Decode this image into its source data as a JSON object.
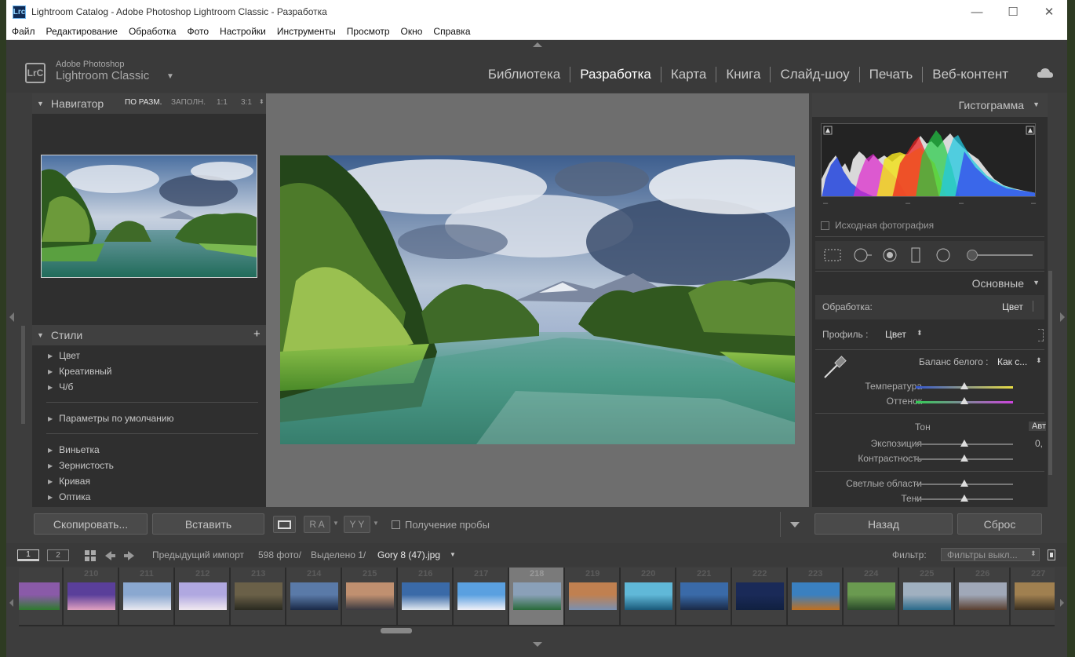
{
  "window": {
    "title": "Lightroom Catalog - Adobe Photoshop Lightroom Classic - Разработка",
    "app_icon": "Lrc",
    "controls": [
      "—",
      "☐",
      "✕"
    ]
  },
  "menu": [
    "Файл",
    "Редактирование",
    "Обработка",
    "Фото",
    "Настройки",
    "Инструменты",
    "Просмотр",
    "Окно",
    "Справка"
  ],
  "brand": {
    "logo": "LrC",
    "line1": "Adobe Photoshop",
    "line2": "Lightroom Classic",
    "arrow": "▼"
  },
  "modules": [
    {
      "label": "Библиотека",
      "active": false
    },
    {
      "label": "Разработка",
      "active": true
    },
    {
      "label": "Карта",
      "active": false
    },
    {
      "label": "Книга",
      "active": false
    },
    {
      "label": "Слайд-шоу",
      "active": false
    },
    {
      "label": "Печать",
      "active": false
    },
    {
      "label": "Веб-контент",
      "active": false
    }
  ],
  "navigator": {
    "title": "Навигатор",
    "options": [
      "ПО РАЗМ.",
      "ЗАПОЛН.",
      "1:1",
      "3:1"
    ],
    "selected_option": "ПО РАЗМ."
  },
  "presets": {
    "title": "Стили",
    "add": "+",
    "group1": [
      "Цвет",
      "Креативный",
      "Ч/б"
    ],
    "group2": [
      "Параметры по умолчанию"
    ],
    "group3": [
      "Виньетка",
      "Зернистость",
      "Кривая",
      "Оптика"
    ]
  },
  "left_buttons": {
    "copy": "Скопировать...",
    "paste": "Вставить"
  },
  "toolbar": {
    "view1": "▭",
    "ra": "R A",
    "yy": "Y Y",
    "sample_label": "Получение пробы",
    "sample_checked": false
  },
  "histogram": {
    "title": "Гистограмма",
    "readouts": [
      "–",
      "–",
      "–",
      "–"
    ],
    "original_label": "Исходная фотография",
    "original_checked": false
  },
  "basic": {
    "title": "Основные",
    "treatment_label": "Обработка:",
    "treatment_value": "Цвет",
    "profile_label": "Профиль :",
    "profile_value": "Цвет",
    "wb_label": "Баланс белого :",
    "wb_value": "Как с...",
    "temp_label": "Температура",
    "tint_label": "Оттенок",
    "tone_label": "Тон",
    "auto_label": "Авт",
    "exposure_label": "Экспозиция",
    "exposure_value": "0,",
    "contrast_label": "Контрастность",
    "highlights_label": "Светлые области",
    "shadows_label": "Тени",
    "sliders": {
      "temp": 0.5,
      "tint": 0.5,
      "exposure": 0.5,
      "contrast": 0.5,
      "highlights": 0.5,
      "shadows": 0.5
    }
  },
  "right_buttons": {
    "back": "Назад",
    "reset": "Сброс"
  },
  "filmhdr": {
    "screen1": "1",
    "screen2": "2",
    "source": "Предыдущий импорт",
    "count": "598 фото/",
    "selected": "Выделено 1/",
    "filename": "Gory 8 (47).jpg",
    "filter_label": "Фильтр:",
    "filter_value": "Фильтры выкл..."
  },
  "filmstrip": {
    "numbers": [
      "",
      "210",
      "211",
      "212",
      "213",
      "214",
      "215",
      "216",
      "217",
      "218",
      "219",
      "220",
      "221",
      "222",
      "223",
      "224",
      "225",
      "226",
      "227"
    ],
    "selected_index": 9,
    "thumb_colors": [
      [
        "#8a5aa8",
        "#2f7a2e"
      ],
      [
        "#5a3f9a",
        "#e0a0c0"
      ],
      [
        "#8aa8d0",
        "#e8e8f0"
      ],
      [
        "#b0a8e0",
        "#f0e8f0"
      ],
      [
        "#6a6048",
        "#2a2a20"
      ],
      [
        "#5a7aa8",
        "#1a2a48"
      ],
      [
        "#c09070",
        "#3a3a40"
      ],
      [
        "#3a6aa8",
        "#e0e8f0"
      ],
      [
        "#5aa0e0",
        "#f0f0f8"
      ],
      [
        "#8aa0b8",
        "#2a6a3a"
      ],
      [
        "#c08050",
        "#7a90b0"
      ],
      [
        "#60b8d8",
        "#1a5a7a"
      ],
      [
        "#3a6aa8",
        "#1a2a48"
      ],
      [
        "#1a2a58",
        "#102040"
      ],
      [
        "#3a80c0",
        "#c07020"
      ],
      [
        "#6a9a50",
        "#2a4a2a"
      ],
      [
        "#a0b0c0",
        "#2a6a8a"
      ],
      [
        "#a0a8b8",
        "#5a4030"
      ],
      [
        "#a08050",
        "#3a3020"
      ]
    ]
  },
  "colors": {
    "panel": "#2f2f2f",
    "accent_white": "#ffffff",
    "background": "#3d3d3d"
  }
}
